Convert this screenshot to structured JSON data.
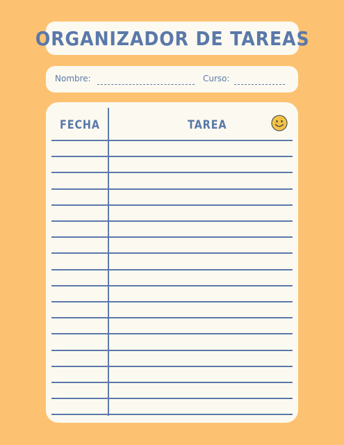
{
  "title": "ORGANIZADOR DE TAREAS",
  "info": {
    "name_label": "Nombre:",
    "course_label": "Curso:"
  },
  "table": {
    "headers": {
      "date": "FECHA",
      "task": "TAREA"
    },
    "row_count": 17,
    "decoration_icon": "smiley-face-icon"
  },
  "colors": {
    "background": "#fdc271",
    "card": "#fcfaf0",
    "ink": "#5a78aa",
    "smiley": "#f5c344"
  }
}
